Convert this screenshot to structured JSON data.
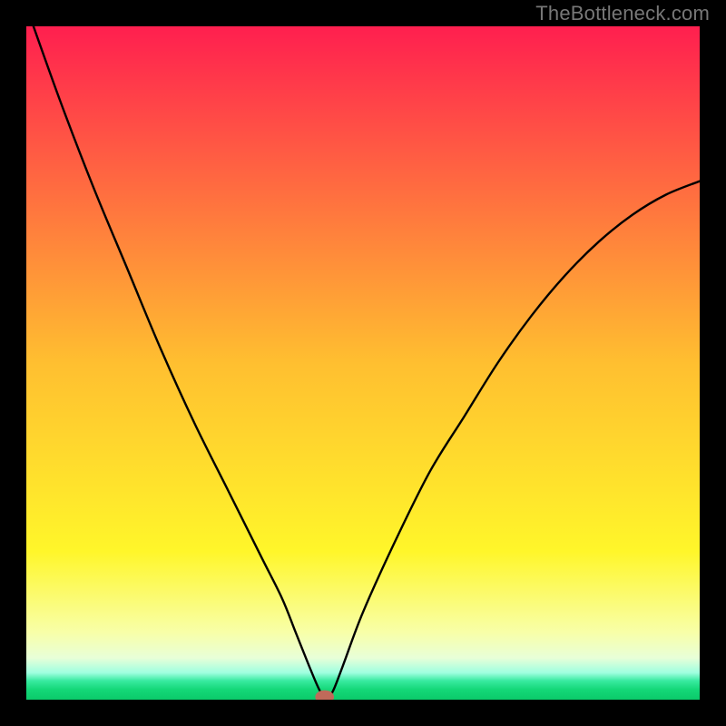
{
  "watermark": {
    "text": "TheBottleneck.com"
  },
  "plot": {
    "outer_size_px": 800,
    "border_px": 29,
    "inner_size_px": 742
  },
  "chart_data": {
    "type": "line",
    "title": "",
    "xlabel": "",
    "ylabel": "",
    "xlim": [
      0,
      100
    ],
    "ylim": [
      0,
      100
    ],
    "axes_visible": false,
    "grid": false,
    "gradient": {
      "direction": "vertical",
      "stops": [
        {
          "offset": 0.0,
          "color": "#ff1f4f"
        },
        {
          "offset": 0.5,
          "color": "#ffbf30"
        },
        {
          "offset": 0.78,
          "color": "#fff62a"
        },
        {
          "offset": 0.9,
          "color": "#f8ffa8"
        },
        {
          "offset": 0.938,
          "color": "#e8ffd8"
        },
        {
          "offset": 0.96,
          "color": "#9fffe0"
        },
        {
          "offset": 0.972,
          "color": "#38eaa0"
        },
        {
          "offset": 0.985,
          "color": "#14d878"
        },
        {
          "offset": 1.0,
          "color": "#0bca6a"
        }
      ]
    },
    "series": [
      {
        "name": "bottleneck-v-curve",
        "stroke": "#000000",
        "stroke_width": 2.4,
        "x": [
          0,
          5,
          10,
          15,
          20,
          25,
          30,
          35,
          38,
          40,
          42,
          43.5,
          44.5,
          45.5,
          47,
          50,
          55,
          60,
          65,
          70,
          75,
          80,
          85,
          90,
          95,
          100
        ],
        "y": [
          103,
          89,
          76,
          64,
          52,
          41,
          31,
          21,
          15,
          10,
          5,
          1.5,
          0.2,
          1.2,
          5,
          13,
          24,
          34,
          42,
          50,
          57,
          63,
          68,
          72,
          75,
          77
        ]
      }
    ],
    "markers": [
      {
        "name": "optimal-point",
        "x": 44.3,
        "y": 0.4,
        "rx": 1.4,
        "ry": 1.0,
        "color": "#c06a5a"
      }
    ]
  }
}
